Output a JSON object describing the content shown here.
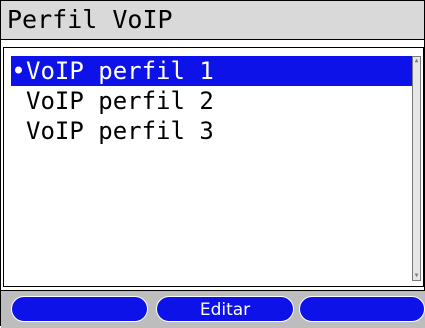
{
  "window": {
    "title": "Perfil VoIP"
  },
  "profiles": {
    "selected_marker": "•",
    "items": [
      {
        "label": "VoIP perfil 1",
        "selected": true
      },
      {
        "label": "VoIP perfil 2",
        "selected": false
      },
      {
        "label": "VoIP perfil 3",
        "selected": false
      }
    ]
  },
  "softkeys": {
    "left": "",
    "center": "Editar",
    "right": ""
  },
  "scrollbar": {
    "up_icon": "arrow-up-icon",
    "down_icon": "arrow-down-icon"
  },
  "colors": {
    "selection": "#0d12e8",
    "titlebar": "#d9d9d9",
    "softkey_bar": "#bdbdbd"
  }
}
